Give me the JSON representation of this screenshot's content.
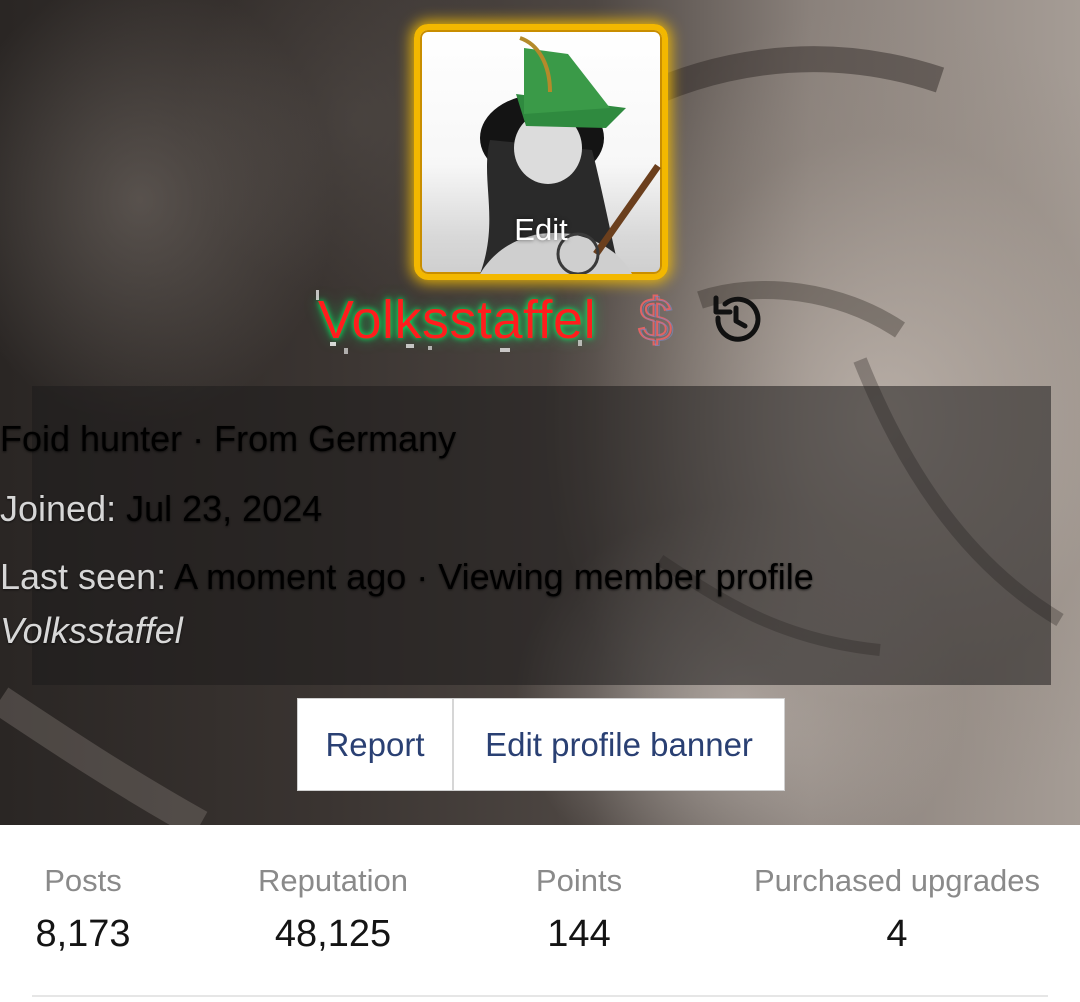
{
  "profile": {
    "avatar_edit_label": "Edit",
    "username": "Volksstaffel",
    "badges": [
      "dollar-badge-icon",
      "history-icon"
    ],
    "info": {
      "title_line": "Foid hunter · From Germany",
      "joined_label": "Joined:",
      "joined_value": "Jul 23, 2024",
      "last_seen_label": "Last seen:",
      "last_seen_value": "A moment ago · Viewing member profile",
      "activity_target": "Volksstaffel"
    },
    "buttons": {
      "report_label": "Report",
      "edit_banner_label": "Edit profile banner"
    }
  },
  "stats": [
    {
      "label": "Posts",
      "value": "8,173"
    },
    {
      "label": "Reputation",
      "value": "48,125"
    },
    {
      "label": "Points",
      "value": "144"
    },
    {
      "label": "Purchased upgrades",
      "value": "4"
    }
  ],
  "colors": {
    "username": "#ff1d1d",
    "username_glow": "#00ff66",
    "avatar_border": "#f3b800",
    "link": "#2a4073"
  }
}
